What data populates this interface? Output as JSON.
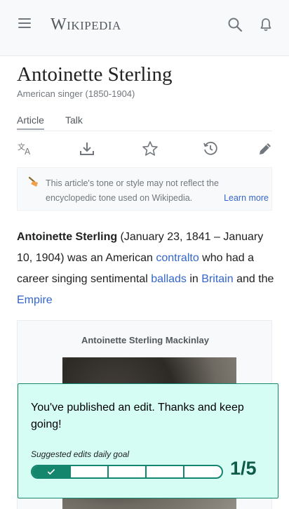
{
  "header": {
    "wordmark": "Wikipedia",
    "menu_icon": "menu-icon",
    "search_icon": "search-icon",
    "notifications_icon": "bell-icon"
  },
  "article": {
    "title": "Antoinette Sterling",
    "description": "American singer (1850-1904)"
  },
  "tabs": [
    {
      "label": "Article",
      "selected": true
    },
    {
      "label": "Talk",
      "selected": false
    }
  ],
  "actions": [
    {
      "name": "language",
      "icon": "language-icon"
    },
    {
      "name": "download",
      "icon": "download-icon"
    },
    {
      "name": "watch",
      "icon": "star-icon"
    },
    {
      "name": "history",
      "icon": "history-icon"
    },
    {
      "name": "edit",
      "icon": "pencil-icon"
    }
  ],
  "notice": {
    "icon": "broom-icon",
    "text": "This article's tone or style may not reflect the encyclopedic tone used on Wikipedia.",
    "learn_more": "Learn more"
  },
  "lead": {
    "subject": "Antoinette Sterling",
    "part1": " (January 23, 1841 – January 10, 1904) was an American ",
    "link_contralto": "contralto",
    "part2": " who had a career singing sentimental ",
    "link_ballads": "ballads",
    "part3": " in ",
    "link_britain": "Britain",
    "part4": " and the ",
    "link_empire": "Empire"
  },
  "infobox": {
    "caption": "Antoinette Sterling Mackinlay"
  },
  "toast": {
    "message": "You've published an edit. Thanks and keep going!",
    "goal_label": "Suggested edits daily goal",
    "count_label": "1/5",
    "progress_done": 1,
    "progress_total": 5,
    "accent_color": "#14866d",
    "background_color": "#d5fdf4"
  },
  "colors": {
    "link": "#3366cc",
    "header_bg": "#f8f9fa",
    "text": "#202122",
    "muted": "#72777d"
  }
}
